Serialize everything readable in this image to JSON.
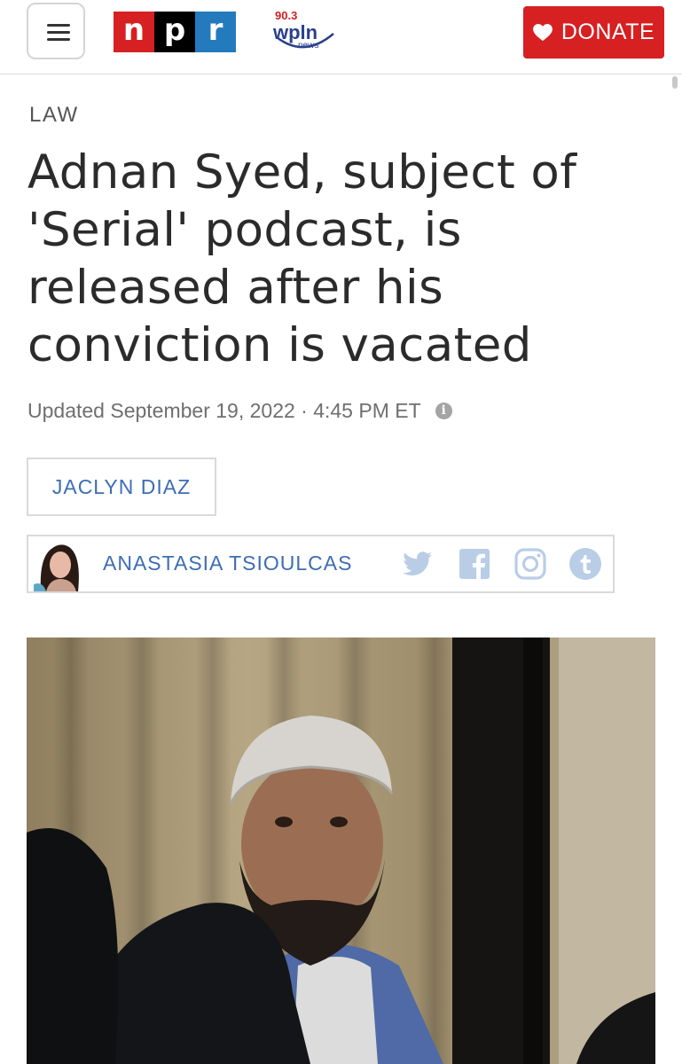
{
  "header": {
    "menu_icon": "hamburger-menu-icon",
    "logo_letters": [
      "n",
      "p",
      "r"
    ],
    "station_logo": {
      "frequency": "90.3",
      "name": "wpln",
      "sub": "news"
    },
    "donate_label": "DONATE",
    "donate_icon": "heart-icon",
    "brand_colors": {
      "npr_red": "#d62021",
      "npr_black": "#000000",
      "npr_blue": "#237bbd"
    }
  },
  "article": {
    "section": "LAW",
    "headline": "Adnan Syed, subject of 'Serial' podcast, is released after his conviction is vacated",
    "dateline": "Updated September 19, 2022 · 4:45 PM ET",
    "info_icon": "info-icon",
    "authors": [
      {
        "name": "JACLYN DIAZ"
      },
      {
        "name": "ANASTASIA TSIOULCAS",
        "social_icons": [
          "twitter-icon",
          "facebook-icon",
          "instagram-icon",
          "tumblr-icon"
        ]
      }
    ],
    "link_color": "#3d6db5"
  }
}
